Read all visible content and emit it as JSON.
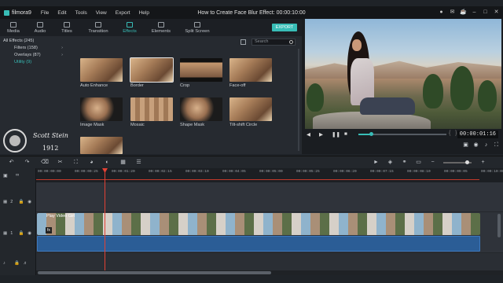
{
  "app": {
    "brand": "filmora9",
    "window_title": "How to Create Face Blur Effect: 00:00:10:00",
    "menu": [
      "File",
      "Edit",
      "Tools",
      "View",
      "Export",
      "Help"
    ]
  },
  "tabs": [
    {
      "label": "Media",
      "icon": "media-icon"
    },
    {
      "label": "Audio",
      "icon": "music-icon"
    },
    {
      "label": "Titles",
      "icon": "titles-icon"
    },
    {
      "label": "Transition",
      "icon": "transition-icon"
    },
    {
      "label": "Effects",
      "icon": "effects-icon",
      "active": true
    },
    {
      "label": "Elements",
      "icon": "elements-icon"
    },
    {
      "label": "Split Screen",
      "icon": "split-screen-icon"
    }
  ],
  "export_label": "EXPORT",
  "categories": [
    {
      "label": "All Effects (245)",
      "level": 0
    },
    {
      "label": "Filters (158)",
      "level": 1
    },
    {
      "label": "Overlays (87)",
      "level": 1
    },
    {
      "label": "Utility (9)",
      "level": 1,
      "selected": true
    }
  ],
  "watermark": {
    "name": "Scott Stein",
    "year": "1912"
  },
  "search": {
    "placeholder": "Search"
  },
  "effects": [
    {
      "label": "Auto Enhance"
    },
    {
      "label": "Border",
      "selected": true
    },
    {
      "label": "Crop"
    },
    {
      "label": "Face-off"
    },
    {
      "label": "Image Mask"
    },
    {
      "label": "Mosaic"
    },
    {
      "label": "Shape Mask"
    },
    {
      "label": "Tilt-shift Circle"
    },
    {
      "label": ""
    }
  ],
  "preview": {
    "timecode": "00:00:01:16",
    "progress": 0.15,
    "controls": [
      "previous-frame-icon",
      "play-icon",
      "pause-icon",
      "stop-icon"
    ]
  },
  "timeline": {
    "ticks": [
      "00:00:00:00",
      "00:00:00:25",
      "00:00:01:20",
      "00:00:02:15",
      "00:00:03:10",
      "00:00:04:05",
      "00:00:05:00",
      "00:00:05:25",
      "00:00:06:20",
      "00:00:07:15",
      "00:00:08:10",
      "00:00:09:05",
      "00:00:10:00"
    ],
    "tracks": [
      {
        "num": "2"
      },
      {
        "num": "1"
      }
    ],
    "clip_name": "Play Video Girl",
    "colors": {
      "accent": "#38bdb7",
      "playhead": "#e34134",
      "audio": "#2b5d96"
    }
  }
}
